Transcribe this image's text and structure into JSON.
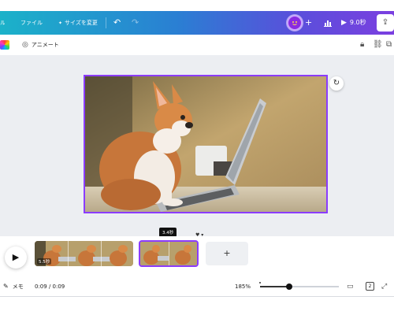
{
  "header": {
    "file_label": "ファイル",
    "resize_label": "サイズを変更",
    "plus_label": "+",
    "play_duration": "9.0秒",
    "colors": {
      "gradient_start": "#1bb2c9",
      "gradient_end": "#7b3fe0",
      "avatar": "#8a2be2"
    }
  },
  "toolbar": {
    "animate_label": "アニメート"
  },
  "canvas": {
    "selection_color": "#8b3cff",
    "image_subject": "chihuahua dog looking at a laptop"
  },
  "timeline": {
    "clips": [
      {
        "duration_label": "5.5秒"
      },
      {
        "duration_label": ""
      }
    ],
    "tooltip_label": "3.4秒",
    "add_label": "+"
  },
  "footer": {
    "notes_label": "メモ",
    "time_label": "0:09 / 0:09",
    "zoom_label": "185%",
    "page_label": "2",
    "zoom_level": 0.37
  },
  "icons": [
    "menu-icon",
    "sparkle-icon",
    "undo-icon",
    "redo-icon",
    "avatar-face-icon",
    "analytics-icon",
    "play-icon",
    "share-icon",
    "lock-icon",
    "link-icon",
    "copy-icon",
    "refresh-icon",
    "notes-icon",
    "grid-view-icon",
    "page-count-icon",
    "fullscreen-icon"
  ]
}
